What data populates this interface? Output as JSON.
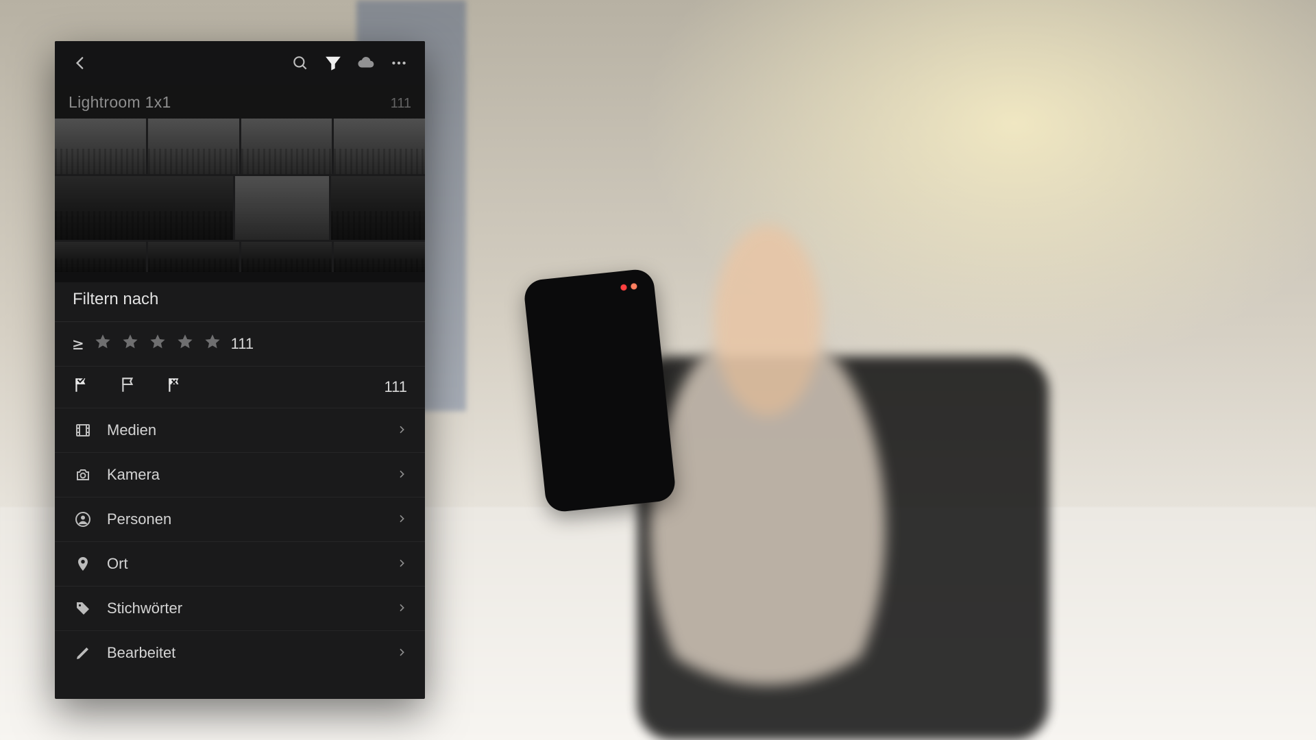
{
  "album": {
    "title": "Lightroom 1x1",
    "count": "111"
  },
  "filter": {
    "title": "Filtern nach",
    "rating_count": "111",
    "flags_count": "111"
  },
  "categories": {
    "media": {
      "label": "Medien"
    },
    "camera": {
      "label": "Kamera"
    },
    "people": {
      "label": "Personen"
    },
    "place": {
      "label": "Ort"
    },
    "keywords": {
      "label": "Stichwörter"
    },
    "edited": {
      "label": "Bearbeitet"
    }
  }
}
